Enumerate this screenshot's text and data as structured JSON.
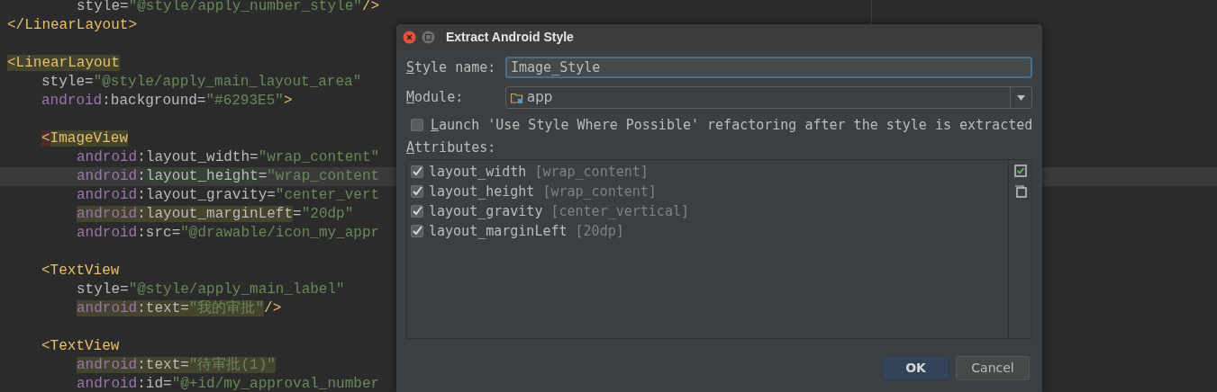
{
  "editor": {
    "lines": [
      {
        "current": false,
        "kind": "deep",
        "segments": [
          {
            "kind": "attr",
            "text": "style"
          },
          {
            "kind": "punct",
            "text": "="
          },
          {
            "kind": "value",
            "text": "\"@style/apply_number_style\""
          },
          {
            "kind": "tag",
            "text": "/>"
          }
        ]
      },
      {
        "current": false,
        "kind": "outer",
        "segments": [
          {
            "kind": "tag",
            "text": "</LinearLayout>"
          }
        ]
      },
      {
        "current": false,
        "kind": "blank"
      },
      {
        "current": false,
        "kind": "outer",
        "segments": [
          {
            "kind": "tag",
            "text": "<LinearLayout",
            "color": "#44432d"
          }
        ]
      },
      {
        "current": false,
        "kind": "inner",
        "segments": [
          {
            "kind": "attr",
            "text": "style"
          },
          {
            "kind": "punct",
            "text": "="
          },
          {
            "kind": "value",
            "text": "\"@style/apply_main_layout_area\""
          }
        ]
      },
      {
        "current": false,
        "kind": "inner",
        "segments": [
          {
            "kind": "ns",
            "text": "android"
          },
          {
            "kind": "punct",
            "text": ":"
          },
          {
            "kind": "attr",
            "text": "background"
          },
          {
            "kind": "punct",
            "text": "="
          },
          {
            "kind": "value",
            "text": "\"#6293E5\""
          },
          {
            "kind": "tag",
            "text": ">"
          }
        ]
      },
      {
        "current": false,
        "kind": "blank"
      },
      {
        "current": false,
        "kind": "inner",
        "segments": [
          {
            "kind": "tag",
            "text": "<",
            "color": "#4a2a2a"
          },
          {
            "kind": "tag",
            "text": "ImageView",
            "color": "#44432d"
          }
        ]
      },
      {
        "current": false,
        "kind": "deep",
        "segments": [
          {
            "kind": "ns",
            "text": "android"
          },
          {
            "kind": "punct",
            "text": ":"
          },
          {
            "kind": "attr",
            "text": "layout_width"
          },
          {
            "kind": "punct",
            "text": "="
          },
          {
            "kind": "value",
            "text": "\"wrap_content\""
          }
        ]
      },
      {
        "current": true,
        "kind": "deep",
        "segments": [
          {
            "kind": "ns",
            "text": "android"
          },
          {
            "kind": "punct",
            "text": ":"
          },
          {
            "kind": "attr",
            "text": "layout_height",
            "color": "#344134"
          },
          {
            "kind": "punct",
            "text": "="
          },
          {
            "kind": "value",
            "text": "\"wrap_content"
          }
        ]
      },
      {
        "current": false,
        "kind": "deep",
        "segments": [
          {
            "kind": "ns",
            "text": "android"
          },
          {
            "kind": "punct",
            "text": ":"
          },
          {
            "kind": "attr",
            "text": "layout_gravity"
          },
          {
            "kind": "punct",
            "text": "="
          },
          {
            "kind": "value",
            "text": "\"center_vert"
          }
        ]
      },
      {
        "current": false,
        "kind": "deep",
        "segments": [
          {
            "kind": "ns",
            "text": "android",
            "color": "#44432d"
          },
          {
            "kind": "punct",
            "text": ":",
            "color": "#44432d"
          },
          {
            "kind": "attr",
            "text": "layout_marginLeft",
            "color": "#44432d"
          },
          {
            "kind": "punct",
            "text": "="
          },
          {
            "kind": "value",
            "text": "\"20dp\""
          }
        ]
      },
      {
        "current": false,
        "kind": "deep",
        "segments": [
          {
            "kind": "ns",
            "text": "android"
          },
          {
            "kind": "punct",
            "text": ":"
          },
          {
            "kind": "attr",
            "text": "src"
          },
          {
            "kind": "punct",
            "text": "="
          },
          {
            "kind": "value",
            "text": "\"@drawable/icon_my_appr"
          }
        ]
      },
      {
        "current": false,
        "kind": "blank"
      },
      {
        "current": false,
        "kind": "inner",
        "segments": [
          {
            "kind": "tag",
            "text": "<TextView"
          }
        ]
      },
      {
        "current": false,
        "kind": "deep",
        "segments": [
          {
            "kind": "attr",
            "text": "style"
          },
          {
            "kind": "punct",
            "text": "="
          },
          {
            "kind": "value",
            "text": "\"@style/apply_main_label\""
          }
        ]
      },
      {
        "current": false,
        "kind": "deep",
        "segments": [
          {
            "kind": "ns",
            "text": "android",
            "color": "#44432d"
          },
          {
            "kind": "punct",
            "text": ":",
            "color": "#44432d"
          },
          {
            "kind": "attr",
            "text": "text",
            "color": "#44432d"
          },
          {
            "kind": "punct",
            "text": "=",
            "color": "#44432d"
          },
          {
            "kind": "value",
            "text": "\"我的审批\"",
            "color": "#44432d"
          },
          {
            "kind": "tag",
            "text": "/>"
          }
        ]
      },
      {
        "current": false,
        "kind": "blank"
      },
      {
        "current": false,
        "kind": "inner",
        "segments": [
          {
            "kind": "tag",
            "text": "<TextView"
          }
        ]
      },
      {
        "current": false,
        "kind": "deep",
        "segments": [
          {
            "kind": "ns",
            "text": "android",
            "color": "#44432d"
          },
          {
            "kind": "punct",
            "text": ":",
            "color": "#44432d"
          },
          {
            "kind": "attr",
            "text": "text",
            "color": "#44432d"
          },
          {
            "kind": "punct",
            "text": "=",
            "color": "#44432d"
          },
          {
            "kind": "value",
            "text": "\"待审批(1)\"",
            "color": "#44432d"
          }
        ]
      },
      {
        "current": false,
        "kind": "deep",
        "segments": [
          {
            "kind": "ns",
            "text": "android"
          },
          {
            "kind": "punct",
            "text": ":"
          },
          {
            "kind": "attr",
            "text": "id"
          },
          {
            "kind": "punct",
            "text": "="
          },
          {
            "kind": "value",
            "text": "\"@+id/my_approval_number"
          }
        ]
      }
    ]
  },
  "dialog": {
    "title": "Extract Android Style",
    "style_name": {
      "label": "Style name:",
      "value": "Image_Style"
    },
    "module": {
      "label": "Module:",
      "value": "app"
    },
    "launch_option": {
      "label": "Launch 'Use Style Where Possible' refactoring after the style is extracted",
      "checked": false
    },
    "attributes": {
      "label": "Attributes:",
      "items": [
        {
          "name": "layout_width",
          "value": "[wrap_content]",
          "checked": true
        },
        {
          "name": "layout_height",
          "value": "[wrap_content]",
          "checked": true
        },
        {
          "name": "layout_gravity",
          "value": "[center_vertical]",
          "checked": true
        },
        {
          "name": "layout_marginLeft",
          "value": "[20dp]",
          "checked": true
        }
      ]
    },
    "buttons": [
      {
        "label": "OK",
        "kind": "primary"
      },
      {
        "label": "Cancel",
        "kind": "secondary"
      }
    ]
  }
}
